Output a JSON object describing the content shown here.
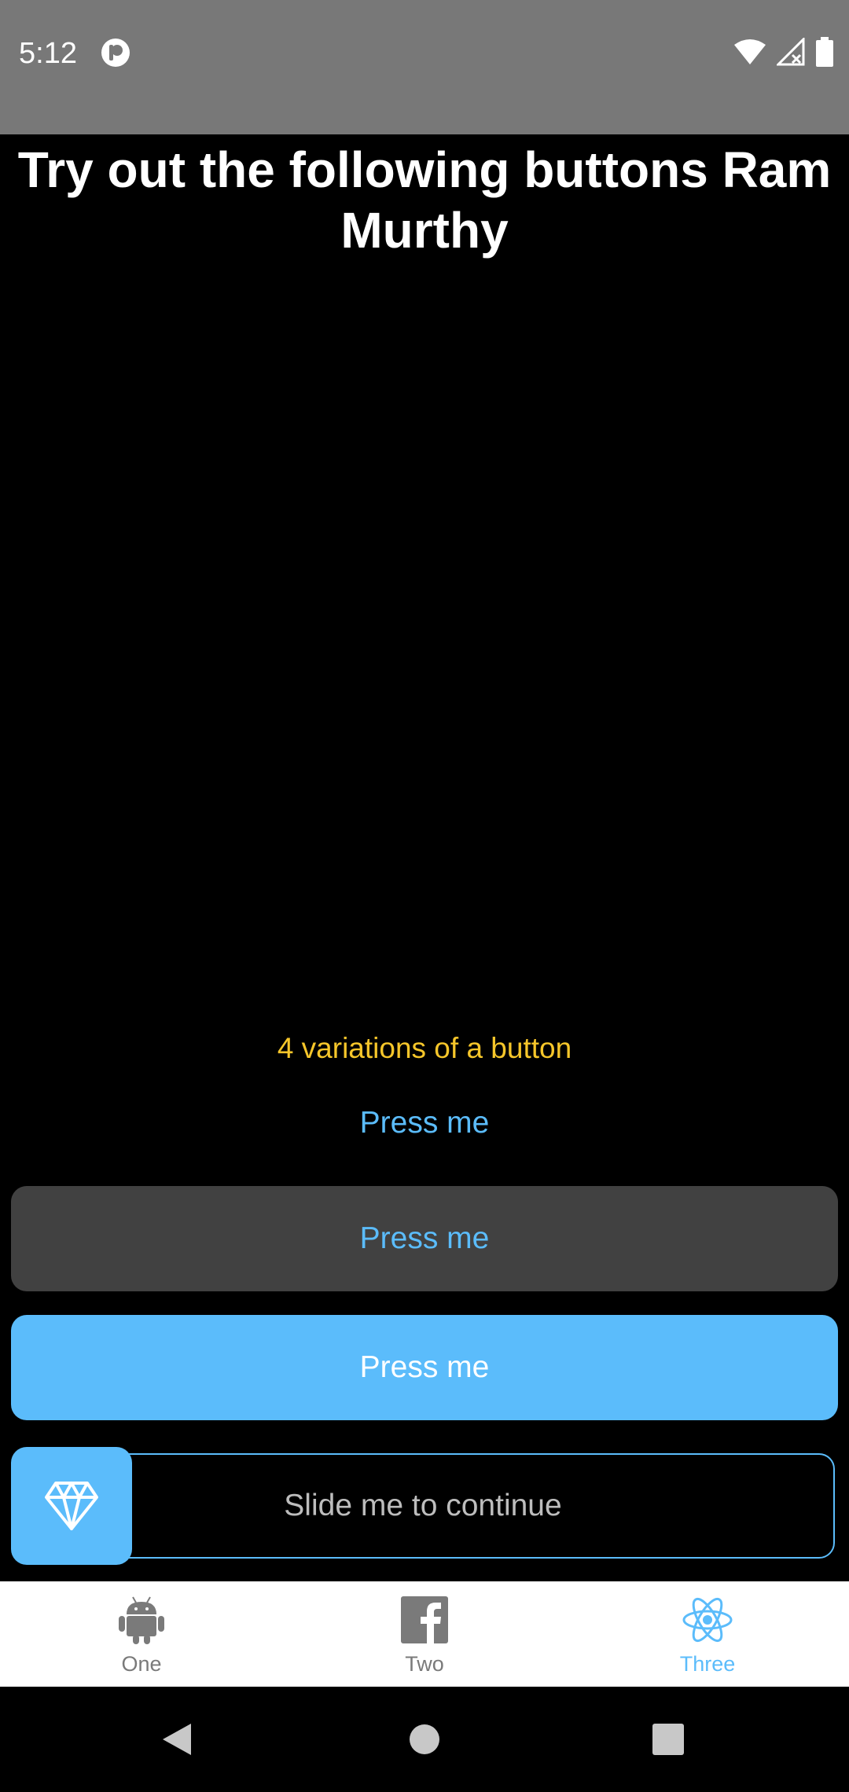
{
  "status_bar": {
    "time": "5:12",
    "icons": [
      "app-icon",
      "wifi-icon",
      "signal-icon",
      "battery-icon"
    ]
  },
  "page": {
    "title": "Try out the following buttons Ram Murthy",
    "variations_label": "4 variations of a button"
  },
  "buttons": {
    "text_button_label": "Press me",
    "gray_button_label": "Press me",
    "blue_button_label": "Press me",
    "slider_label": "Slide me to continue",
    "slider_thumb_icon": "diamond-icon"
  },
  "tabs": [
    {
      "label": "One",
      "icon": "android-icon",
      "active": false
    },
    {
      "label": "Two",
      "icon": "facebook-icon",
      "active": false
    },
    {
      "label": "Three",
      "icon": "react-icon",
      "active": true
    }
  ],
  "nav": {
    "icons": [
      "back-icon",
      "home-icon",
      "recents-icon"
    ]
  },
  "colors": {
    "accent": "#5bbcfb",
    "label_yellow": "#f6c62a",
    "status_bar": "#787878",
    "gray_button": "#414141",
    "inactive_tab": "#7a7a7a"
  }
}
